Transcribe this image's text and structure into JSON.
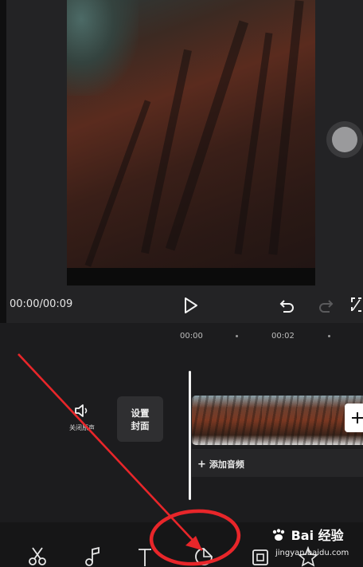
{
  "player": {
    "time": "00:00/00:09"
  },
  "ruler": {
    "label_0": "00:00",
    "label_1": "00:02"
  },
  "track": {
    "mute_label": "关闭原声",
    "cover_label": "设置封面",
    "add_audio": "添加音频"
  },
  "watermark": {
    "logo": "Bai 经验",
    "url": "jingyan.baidu.com"
  },
  "colors": {
    "annotation": "#e8262a",
    "accent": "#36e3d9",
    "background": "#1b1b1d"
  },
  "icons": [
    "play-icon",
    "undo-icon",
    "redo-icon",
    "fullscreen-icon",
    "speaker-icon",
    "scissors-icon",
    "music-note-icon",
    "text-icon",
    "sticker-icon",
    "filter-icon",
    "effects-icon"
  ]
}
